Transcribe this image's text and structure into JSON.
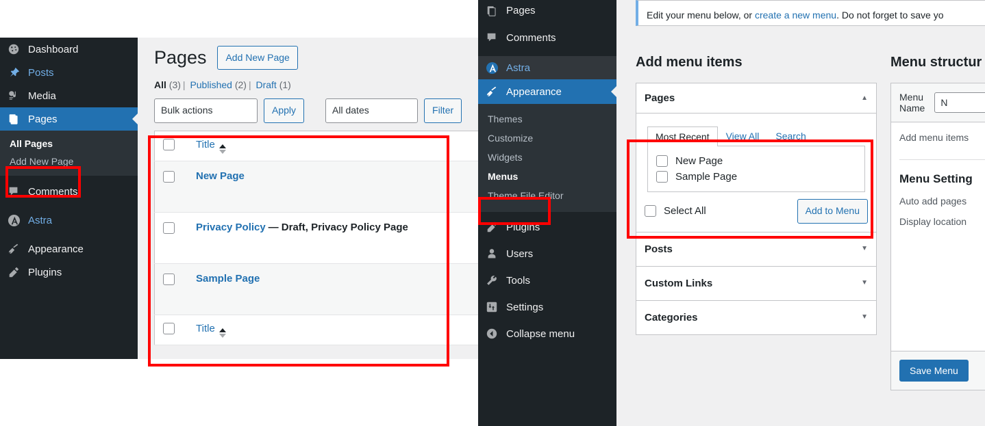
{
  "pages_screen": {
    "sidebar": [
      {
        "label": "Dashboard",
        "icon": "dashboard-icon",
        "state": "normal"
      },
      {
        "label": "Posts",
        "icon": "pin-icon",
        "state": "hover"
      },
      {
        "label": "Media",
        "icon": "media-icon",
        "state": "normal"
      },
      {
        "label": "Pages",
        "icon": "pages-icon",
        "state": "current"
      },
      {
        "label": "Comments",
        "icon": "comment-icon",
        "state": "normal"
      },
      {
        "label": "Astra",
        "icon": "astra-icon",
        "state": "hover"
      },
      {
        "label": "Appearance",
        "icon": "brush-icon",
        "state": "normal"
      },
      {
        "label": "Plugins",
        "icon": "plug-icon",
        "state": "normal"
      }
    ],
    "submenu": [
      {
        "label": "All Pages",
        "current": true
      },
      {
        "label": "Add New Page",
        "current": false
      }
    ],
    "heading": "Pages",
    "add_new_button": "Add New Page",
    "status_filters": [
      {
        "label": "All",
        "count": "(3)",
        "current": true
      },
      {
        "label": "Published",
        "count": "(2)",
        "current": false
      },
      {
        "label": "Draft",
        "count": "(1)",
        "current": false
      }
    ],
    "bulk_actions_value": "Bulk actions",
    "apply_button": "Apply",
    "dates_value": "All dates",
    "filter_button": "Filter",
    "column_title": "Title",
    "rows": [
      {
        "title": "New Page",
        "state": ""
      },
      {
        "title": "Privacy Policy",
        "state": "— Draft, Privacy Policy Page"
      },
      {
        "title": "Sample Page",
        "state": ""
      }
    ]
  },
  "appearance_screen": {
    "items": [
      {
        "label": "Pages",
        "icon": "pages-icon",
        "state": "normal"
      },
      {
        "label": "Comments",
        "icon": "comment-icon",
        "state": "normal"
      },
      {
        "label": "Astra",
        "icon": "astra-icon",
        "state": "hover"
      },
      {
        "label": "Appearance",
        "icon": "brush-icon",
        "state": "current"
      }
    ],
    "submenu": [
      {
        "label": "Themes",
        "current": false
      },
      {
        "label": "Customize",
        "current": false
      },
      {
        "label": "Widgets",
        "current": false
      },
      {
        "label": "Menus",
        "current": true
      },
      {
        "label": "Theme File Editor",
        "current": false
      }
    ],
    "items_after": [
      {
        "label": "Plugins",
        "icon": "plug-icon",
        "state": "normal"
      },
      {
        "label": "Users",
        "icon": "user-icon",
        "state": "normal"
      },
      {
        "label": "Tools",
        "icon": "wrench-icon",
        "state": "normal"
      },
      {
        "label": "Settings",
        "icon": "settings-icon",
        "state": "normal"
      },
      {
        "label": "Collapse menu",
        "icon": "collapse-icon",
        "state": "normal"
      }
    ]
  },
  "menus_screen": {
    "notice_prefix": "Edit your menu below, or ",
    "notice_link": "create a new menu",
    "notice_suffix": ". Do not forget to save yo",
    "add_menu_items_heading": "Add menu items",
    "menu_structure_heading": "Menu structur",
    "accordion": {
      "pages_title": "Pages",
      "pages_caret": "caret-up-icon",
      "tabs": [
        {
          "label": "Most Recent",
          "active": true
        },
        {
          "label": "View All",
          "active": false
        },
        {
          "label": "Search",
          "active": false
        }
      ],
      "page_checkboxes": [
        "New Page",
        "Sample Page"
      ],
      "select_all_label": "Select All",
      "add_to_menu_button": "Add to Menu",
      "closed_panels": [
        {
          "label": "Posts",
          "caret": "caret-down-icon"
        },
        {
          "label": "Custom Links",
          "caret": "caret-down-icon"
        },
        {
          "label": "Categories",
          "caret": "caret-down-icon"
        }
      ]
    },
    "structure": {
      "menu_name_label": "Menu Name",
      "menu_name_value": "N",
      "add_menu_items_text": "Add menu items",
      "menu_settings_heading": "Menu Setting",
      "auto_add_pages_label": "Auto add pages",
      "display_location_label": "Display location",
      "save_menu_button": "Save Menu"
    }
  },
  "annotations": {
    "color": "#ff0000",
    "boxes": [
      "all-pages-menu-item",
      "pages-list-table",
      "menus-submenu-item",
      "most-recent-tab-panel"
    ]
  }
}
